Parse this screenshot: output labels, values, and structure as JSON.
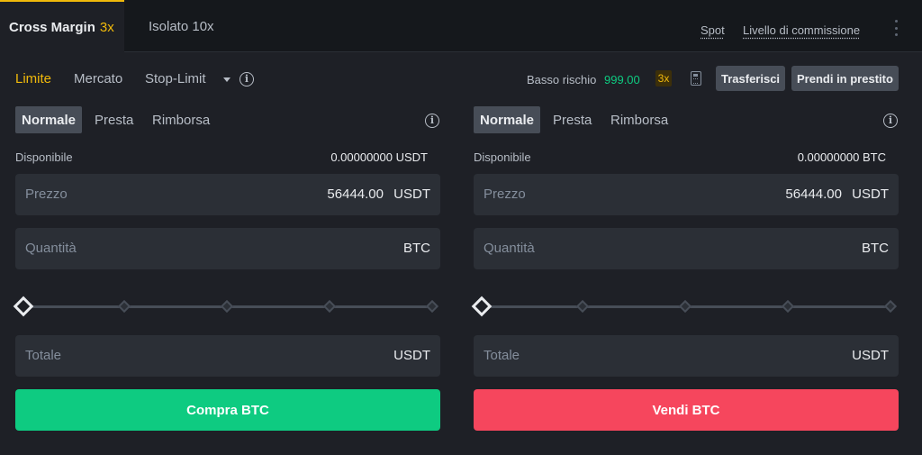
{
  "header": {
    "cross_tab": "Cross Margin",
    "cross_leverage": "3x",
    "isolated_tab": "Isolato 10x",
    "spot_link": "Spot",
    "fee_link": "Livello di commissione"
  },
  "order_types": {
    "limit": "Limite",
    "market": "Mercato",
    "stop_limit": "Stop-Limit",
    "info": "i"
  },
  "risk": {
    "label": "Basso rischio",
    "value": "999.00",
    "leverage": "3x"
  },
  "actions": {
    "transfer": "Trasferisci",
    "borrow": "Prendi in prestito"
  },
  "buy": {
    "tabs": [
      "Normale",
      "Presta",
      "Rimborsa"
    ],
    "info": "i",
    "available_label": "Disponibile",
    "available_value": "0.00000000 USDT",
    "price_label": "Prezzo",
    "price_value": "56444.00",
    "price_unit": "USDT",
    "qty_label": "Quantità",
    "qty_unit": "BTC",
    "slider_percent": 0,
    "total_label": "Totale",
    "total_unit": "USDT",
    "submit": "Compra BTC"
  },
  "sell": {
    "tabs": [
      "Normale",
      "Presta",
      "Rimborsa"
    ],
    "info": "i",
    "available_label": "Disponibile",
    "available_value": "0.00000000 BTC",
    "price_label": "Prezzo",
    "price_value": "56444.00",
    "price_unit": "USDT",
    "qty_label": "Quantità",
    "qty_unit": "BTC",
    "slider_percent": 0,
    "total_label": "Totale",
    "total_unit": "USDT",
    "submit": "Vendi BTC"
  },
  "colors": {
    "accent": "#f0b90b",
    "buy": "#0ecb81",
    "sell": "#f6465d",
    "panel": "#1e2026",
    "field": "#2b2f36"
  }
}
